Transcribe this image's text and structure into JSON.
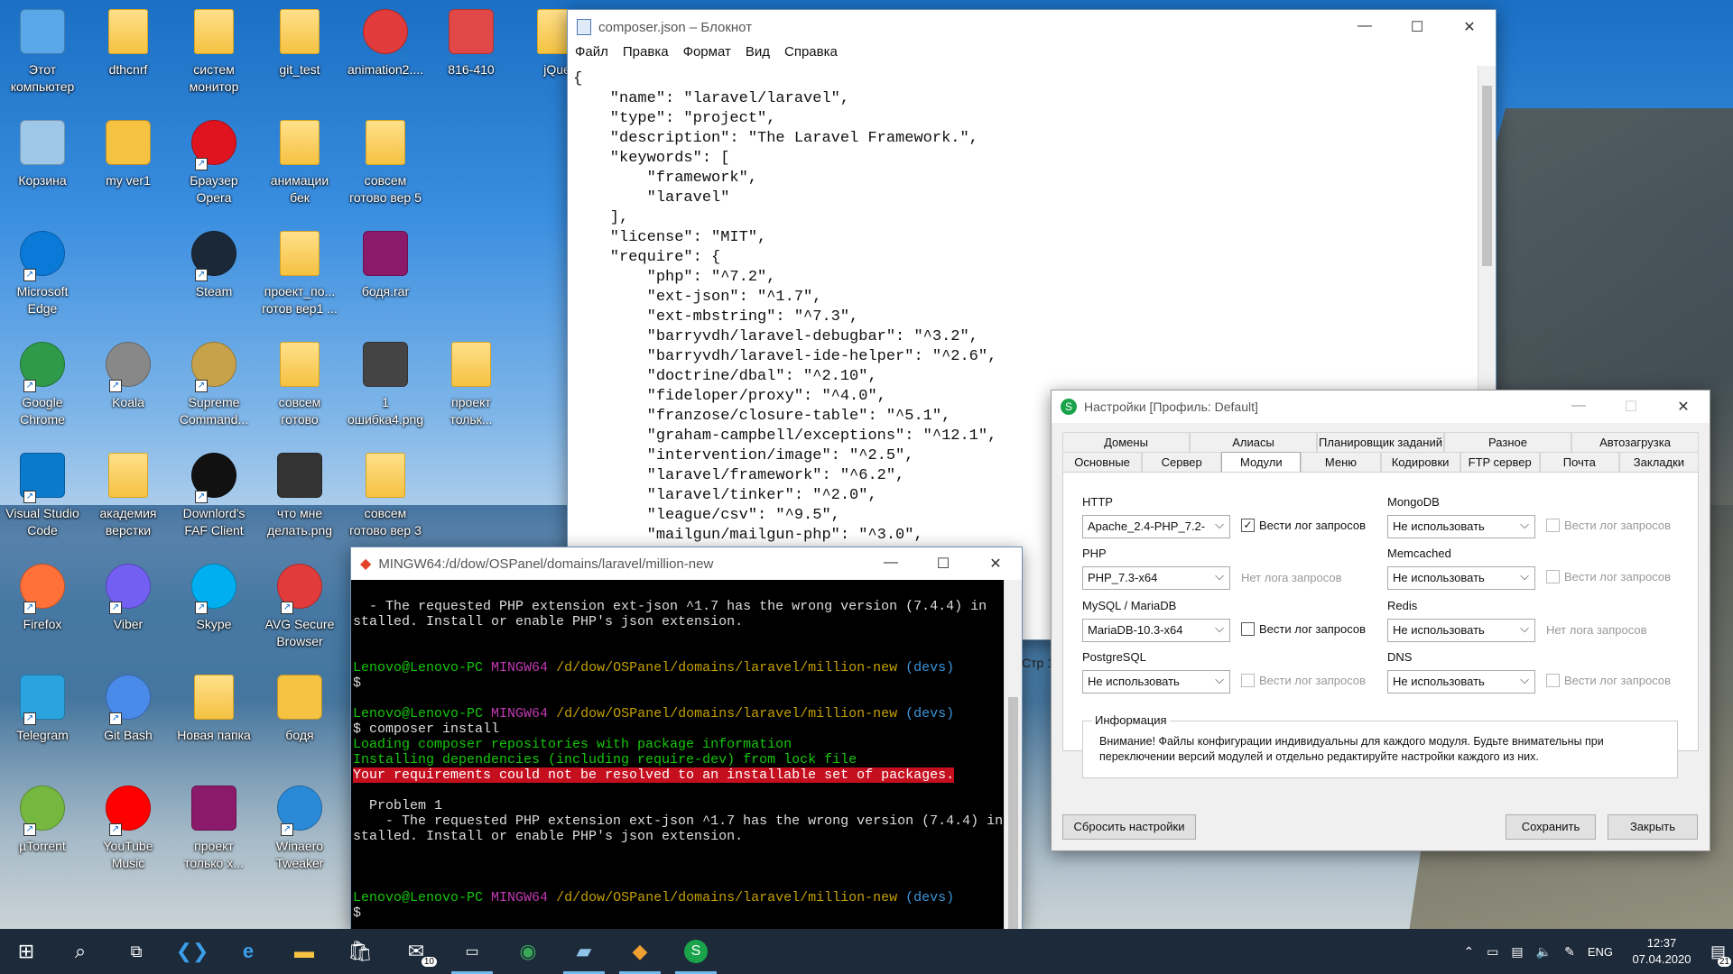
{
  "desktop_icons": [
    {
      "label": "Этот компьютер",
      "icon": "computer-icon",
      "color": "#5aa8e8",
      "shortcut": false
    },
    {
      "label": "dthcnrf",
      "icon": "folder-icon",
      "color": "#f5c242",
      "shortcut": false
    },
    {
      "label": "систем монитор",
      "icon": "folder-icon",
      "color": "#f5c242",
      "shortcut": false
    },
    {
      "label": "git_test",
      "icon": "folder-icon",
      "color": "#f5c242",
      "shortcut": false
    },
    {
      "label": "animation2....",
      "icon": "avast-browser-icon",
      "color": "#e23b3b",
      "shortcut": false
    },
    {
      "label": "816-410",
      "icon": "file-icon",
      "color": "#e04848",
      "shortcut": false
    },
    {
      "label": "jQue",
      "icon": "folder-icon",
      "color": "#f5c242",
      "shortcut": false
    },
    {
      "label": "Корзина",
      "icon": "recycle-bin-icon",
      "color": "#9fc8e8",
      "shortcut": false
    },
    {
      "label": "my ver1",
      "icon": "file-icon",
      "color": "#f5c242",
      "shortcut": false
    },
    {
      "label": "Браузер Opera",
      "icon": "opera-icon",
      "color": "#e0141e",
      "shortcut": true
    },
    {
      "label": "анимации бек",
      "icon": "folder-icon",
      "color": "#f5c242",
      "shortcut": false
    },
    {
      "label": "совсем готово вер 5",
      "icon": "folder-icon",
      "color": "#f5c242",
      "shortcut": false
    },
    {
      "label": "Microsoft Edge",
      "icon": "edge-icon",
      "color": "#0a7ad8",
      "shortcut": true
    },
    {
      "label": "Steam",
      "icon": "steam-icon",
      "color": "#1b2838",
      "shortcut": true
    },
    {
      "label": "проект_по... готов вер1 ...",
      "icon": "folder-icon",
      "color": "#f5c242",
      "shortcut": false
    },
    {
      "label": "бодя.rar",
      "icon": "winrar-icon",
      "color": "#8b1a6b",
      "shortcut": false
    },
    {
      "label": "Google Chrome",
      "icon": "chrome-icon",
      "color": "#2f9a49",
      "shortcut": true
    },
    {
      "label": "Koala",
      "icon": "koala-icon",
      "color": "#888888",
      "shortcut": true
    },
    {
      "label": "Supreme Command...",
      "icon": "supreme-commander-icon",
      "color": "#c8a24a",
      "shortcut": true
    },
    {
      "label": "совсем готово",
      "icon": "folder-icon",
      "color": "#f5c242",
      "shortcut": false
    },
    {
      "label": "1 ошибка4.png",
      "icon": "image-icon",
      "color": "#444444",
      "shortcut": false
    },
    {
      "label": "проект тольк...",
      "icon": "folder-icon",
      "color": "#f5c242",
      "shortcut": false
    },
    {
      "label": "Visual Studio Code",
      "icon": "vscode-icon",
      "color": "#0a7acc",
      "shortcut": true
    },
    {
      "label": "академия верстки",
      "icon": "folder-icon",
      "color": "#f5c242",
      "shortcut": false
    },
    {
      "label": "Downlord's FAF Client",
      "icon": "faf-icon",
      "color": "#111111",
      "shortcut": true
    },
    {
      "label": "что мне делать.png",
      "icon": "image-icon",
      "color": "#333333",
      "shortcut": false
    },
    {
      "label": "совсем готово вер 3",
      "icon": "folder-icon",
      "color": "#f5c242",
      "shortcut": false
    },
    {
      "label": "Firefox",
      "icon": "firefox-icon",
      "color": "#ff7139",
      "shortcut": true
    },
    {
      "label": "Viber",
      "icon": "viber-icon",
      "color": "#7360f2",
      "shortcut": true
    },
    {
      "label": "Skype",
      "icon": "skype-icon",
      "color": "#00aff0",
      "shortcut": true
    },
    {
      "label": "AVG Secure Browser",
      "icon": "avg-browser-icon",
      "color": "#e23b3b",
      "shortcut": true
    },
    {
      "label": "Telegram",
      "icon": "telegram-icon",
      "color": "#2aa3de",
      "shortcut": true
    },
    {
      "label": "Git Bash",
      "icon": "git-bash-icon",
      "color": "#4a8ae8",
      "shortcut": true
    },
    {
      "label": "Новая папка",
      "icon": "folder-icon",
      "color": "#f5c242",
      "shortcut": false
    },
    {
      "label": "бодя",
      "icon": "file-icon",
      "color": "#f5c242",
      "shortcut": false
    },
    {
      "label": "µTorrent",
      "icon": "utorrent-icon",
      "color": "#76b83f",
      "shortcut": true
    },
    {
      "label": "YouTube Music",
      "icon": "youtube-music-icon",
      "color": "#ff0000",
      "shortcut": true
    },
    {
      "label": "проект только х...",
      "icon": "winrar-icon",
      "color": "#8b1a6b",
      "shortcut": false
    },
    {
      "label": "Winaero Tweaker",
      "icon": "winaero-icon",
      "color": "#2a8ad8",
      "shortcut": true
    }
  ],
  "notepad": {
    "title": "composer.json – Блокнот",
    "menu": [
      "Файл",
      "Правка",
      "Формат",
      "Вид",
      "Справка"
    ],
    "status_partial": "Стр 1",
    "content": "{\n    \"name\": \"laravel/laravel\",\n    \"type\": \"project\",\n    \"description\": \"The Laravel Framework.\",\n    \"keywords\": [\n        \"framework\",\n        \"laravel\"\n    ],\n    \"license\": \"MIT\",\n    \"require\": {\n        \"php\": \"^7.2\",\n        \"ext-json\": \"^1.7\",\n        \"ext-mbstring\": \"^7.3\",\n        \"barryvdh/laravel-debugbar\": \"^3.2\",\n        \"barryvdh/laravel-ide-helper\": \"^2.6\",\n        \"doctrine/dbal\": \"^2.10\",\n        \"fideloper/proxy\": \"^4.0\",\n        \"franzose/closure-table\": \"^5.1\",\n        \"graham-campbell/exceptions\": \"^12.1\",\n        \"intervention/image\": \"^2.5\",\n        \"laravel/framework\": \"^6.2\",\n        \"laravel/tinker\": \"^2.0\",\n        \"league/csv\": \"^9.5\",\n        \"mailgun/mailgun-php\": \"^3.0\","
  },
  "terminal": {
    "title": "MINGW64:/d/dow/OSPanel/domains/laravel/million-new",
    "user_host": "Lenovo@Lenovo-PC",
    "shell": "MINGW64",
    "path": "/d/dow/OSPanel/domains/laravel/million-new",
    "branch": "(devs)",
    "prompt": "$",
    "command": "$ composer install",
    "line_ext1": "  - The requested PHP extension ext-json ^1.7 has the wrong version (7.4.4) in",
    "line_ext2": "stalled. Install or enable PHP's json extension.",
    "loading": "Loading composer repositories with package information",
    "installing": "Installing dependencies (including require-dev) from lock file",
    "error": "Your requirements could not be resolved to an installable set of packages.",
    "problem": "  Problem 1",
    "ext_prefix": "    - The requested PHP extension ext-json ^1.7 has the wrong version (7.4.4) in"
  },
  "settings": {
    "title": "Настройки [Профиль: Default]",
    "tabs_row1": [
      "Домены",
      "Алиасы",
      "Планировщик заданий",
      "Разное",
      "Автозагрузка"
    ],
    "tabs_row2": [
      "Основные",
      "Сервер",
      "Модули",
      "Меню",
      "Кодировки",
      "FTP сервер",
      "Почта",
      "Закладки"
    ],
    "active_tab": "Модули",
    "http_label": "HTTP",
    "http_value": "Apache_2.4-PHP_7.2-",
    "php_label": "PHP",
    "php_value": "PHP_7.3-x64",
    "mysql_label": "MySQL / MariaDB",
    "mysql_value": "MariaDB-10.3-x64",
    "pg_label": "PostgreSQL",
    "pg_value": "Не использовать",
    "mongo_label": "MongoDB",
    "mongo_value": "Не использовать",
    "memcached_label": "Memcached",
    "memcached_value": "Не использовать",
    "redis_label": "Redis",
    "redis_value": "Не использовать",
    "dns_label": "DNS",
    "dns_value": "Не использовать",
    "log_label": "Вести лог запросов",
    "no_log_label": "Нет лога запросов",
    "info_title": "Информация",
    "info_text": "Внимание! Файлы конфигурации индивидуальны для каждого модуля. Будьте внимательны при переключении версий модулей и отдельно редактируйте настройки каждого из них.",
    "reset_button": "Сбросить настройки",
    "save_button": "Сохранить",
    "close_button": "Закрыть"
  },
  "taskbar": {
    "mail_badge": "10",
    "lang": "ENG",
    "time": "12:37",
    "date": "07.04.2020",
    "notifications": "21"
  }
}
